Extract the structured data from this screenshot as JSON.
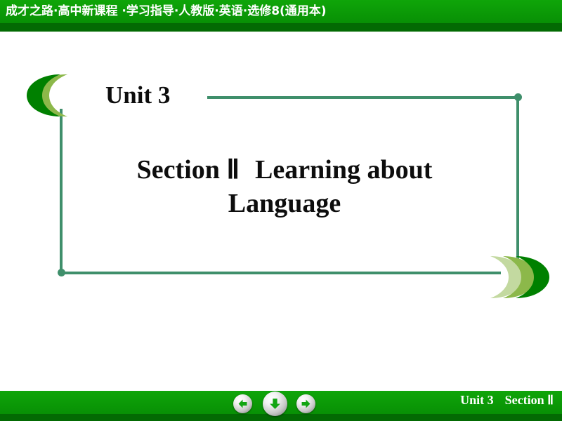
{
  "header": {
    "title": "成才之路·高中新课程 ·学习指导·人教版·英语·选修8(通用本)",
    "bg_color": "#0a9c05",
    "shadow_color": "#036a03",
    "text_color": "#ffffff"
  },
  "body": {
    "unit_label": "Unit 3",
    "section_number": "Section Ⅱ",
    "section_title_line1": "Learning about",
    "section_title_line2": "Language",
    "frame_color": "#3f8f6b",
    "text_color": "#0d0d0d"
  },
  "decorations": {
    "left_chevrons_name": "triple-chevron-left",
    "right_chevrons_name": "triple-chevron-right",
    "chevron_colors": [
      "#008000",
      "#8cb84a",
      "#c3d9a0"
    ]
  },
  "footer": {
    "unit_label": "Unit 3",
    "section_label": "Section Ⅱ",
    "bg_color": "#0a9c05",
    "text_color": "#ffffff",
    "nav": {
      "back_label": "Back",
      "down_label": "Down",
      "forward_label": "Forward",
      "arrow_color": "#12a512"
    }
  }
}
